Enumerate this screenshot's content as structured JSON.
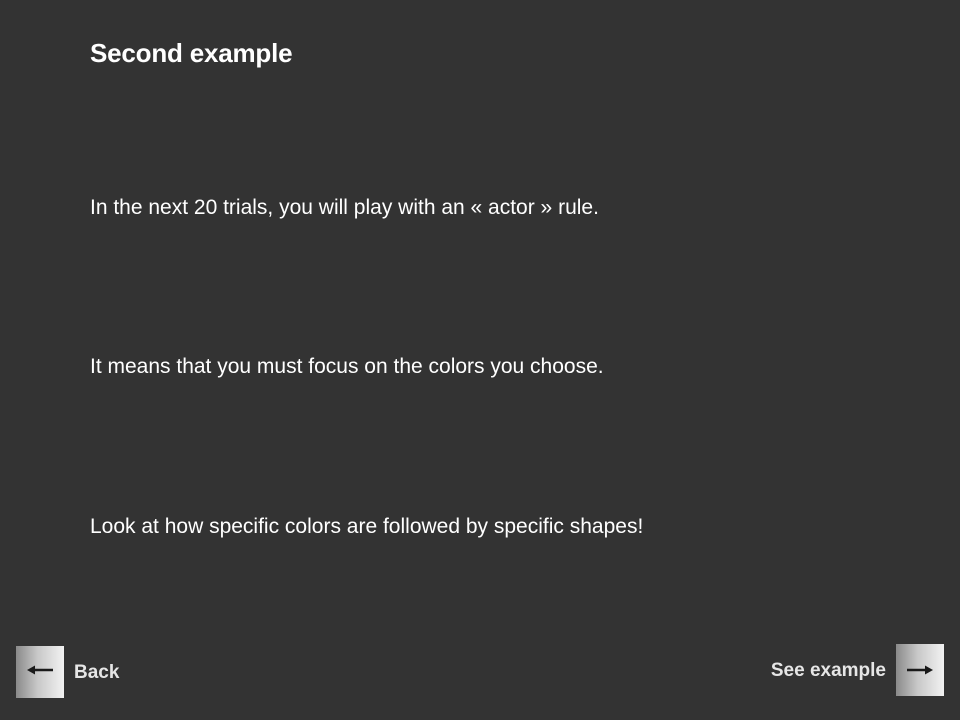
{
  "slide": {
    "title": "Second example",
    "paragraphs": [
      "In the next 20 trials, you will play with an « actor » rule.",
      "It means that you must focus on the colors you choose.",
      "Look at how specific colors are followed by specific shapes!"
    ]
  },
  "nav": {
    "back_label": "Back",
    "back_icon": "arrow-left-icon",
    "next_label": "See example",
    "next_icon": "arrow-right-icon"
  },
  "colors": {
    "background": "#333333",
    "text": "#ffffff"
  }
}
